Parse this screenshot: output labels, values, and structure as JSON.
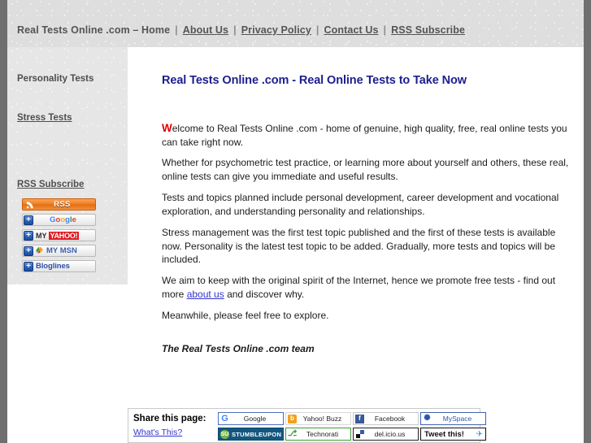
{
  "header": {
    "site_title": "Real Tests Online .com – Home",
    "separator": "|",
    "nav": [
      {
        "label": "About Us"
      },
      {
        "label": "Privacy Policy"
      },
      {
        "label": "Contact Us"
      },
      {
        "label": "RSS Subscribe"
      }
    ]
  },
  "sidebar": {
    "items": [
      {
        "label": "Personality Tests"
      },
      {
        "label": "Stress Tests"
      }
    ],
    "rss_heading": "RSS Subscribe",
    "rss_buttons": [
      {
        "name": "rss",
        "label": "RSS",
        "icon": "rss-icon"
      },
      {
        "name": "google",
        "label": "Google",
        "icon": "plus-icon"
      },
      {
        "name": "my-yahoo",
        "label_my": "MY",
        "label_brand": "YAHOO!",
        "icon": "plus-icon"
      },
      {
        "name": "my-msn",
        "label": "MY MSN",
        "icon": "plus-icon"
      },
      {
        "name": "bloglines",
        "label": "Bloglines",
        "icon": "plus-icon"
      }
    ]
  },
  "main": {
    "title": "Real Tests Online .com - Real Online Tests to Take Now",
    "p1_cap": "W",
    "p1": "elcome to Real Tests Online .com - home of genuine, high quality, free, real online tests you can take right now.",
    "p2": "Whether for psychometric test practice, or learning more about yourself and others, these real, online tests can give you immediate and useful results.",
    "p3": "Tests and topics planned include personal development, career development and vocational exploration, and understanding personality and relationships.",
    "p4": "Stress management was the first test topic published and the first of these tests is available now. Personality is the latest test topic to be added. Gradually, more tests and topics will be included.",
    "p5_before": "We aim to keep with the original spirit of the Internet, hence we promote free tests - find out more ",
    "p5_link": "about us",
    "p5_after": " and discover why.",
    "p6": "Meanwhile, please feel free to explore.",
    "signoff": "The Real Tests Online .com team"
  },
  "share": {
    "label": "Share this page:",
    "whats_this": "What's This?",
    "buttons": [
      {
        "name": "google",
        "label": "Google",
        "mark": "G"
      },
      {
        "name": "yahoo-buzz",
        "label": "Yahoo! Buzz",
        "mark": "b"
      },
      {
        "name": "facebook",
        "label": "Facebook",
        "mark": "f"
      },
      {
        "name": "myspace",
        "label": "MySpace",
        "mark": "✺"
      },
      {
        "name": "stumbleupon",
        "label": "STUMBLEUPON",
        "mark": "SU"
      },
      {
        "name": "technorati",
        "label": "Technorati",
        "mark": "⎇"
      },
      {
        "name": "delicious",
        "label": "del.icio.us",
        "mark": ""
      },
      {
        "name": "tweet",
        "label": "Tweet this!",
        "mark": "✈"
      }
    ]
  },
  "colors": {
    "heading": "#1d1d8f",
    "link": "#3333cc",
    "dropcap": "#e00000",
    "header_bg": "#dedede",
    "sidebar_bg": "#e6e6e6",
    "page_gutter": "#6f6f6f",
    "rss_orange": "#f07d20"
  }
}
